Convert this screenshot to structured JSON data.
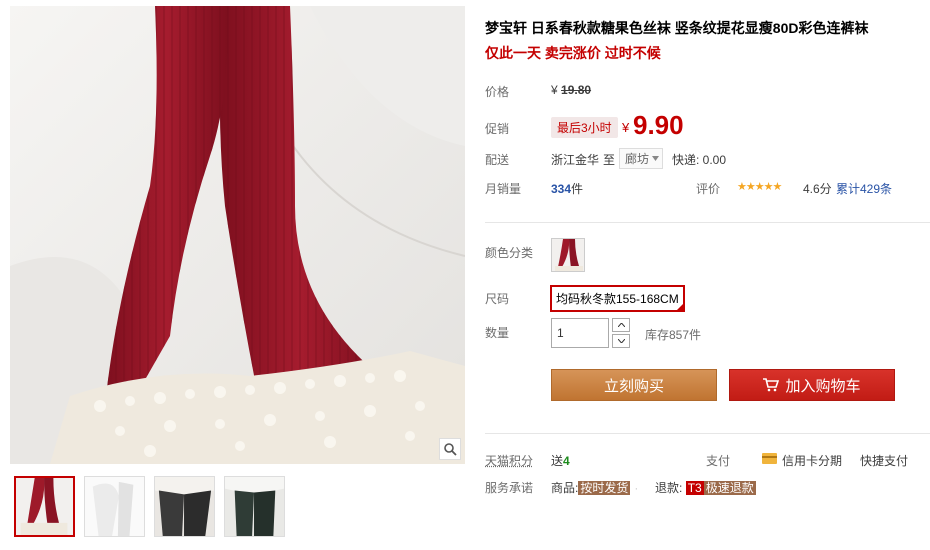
{
  "product": {
    "title": "梦宝轩 日系春秋款糖果色丝袜 竖条纹提花显瘦80D彩色连裤袜",
    "subtitle": "仅此一天 卖完涨价 过时不候"
  },
  "price": {
    "label": "价格",
    "currency": "¥",
    "original": "19.80"
  },
  "promo": {
    "label": "促销",
    "badge": "最后3小时",
    "currency": "¥",
    "price": "9.90"
  },
  "shipping": {
    "label": "配送",
    "from": "浙江金华",
    "to_word": "至",
    "destination": "廊坊",
    "fee": "快递: 0.00"
  },
  "sales": {
    "label": "月销量",
    "count": "334",
    "unit": "件",
    "rating_label": "评价",
    "stars": "★★★★★",
    "rating_value": 4.6,
    "score": "4.6分",
    "review_count": "累计429条"
  },
  "options": {
    "color_label": "颜色分类",
    "size_label": "尺码",
    "size_selected": "均码秋冬款155-168CM",
    "qty_label": "数量",
    "qty_value": "1",
    "stock": "库存857件"
  },
  "actions": {
    "buy_now": "立刻购买",
    "add_cart": "加入购物车"
  },
  "extra": {
    "points_label": "天猫积分",
    "points_give": "送",
    "points_value": "4",
    "pay_label": "支付",
    "credit": "信用卡分期",
    "fast_pay": "快捷支付",
    "service_label": "服务承诺",
    "goods_label": "商品:",
    "goods_badge": "按时发货",
    "refund_label": "退款:",
    "refund_code": "T3",
    "refund_badge": "极速退款"
  },
  "colors": {
    "accent": "#c40000",
    "buy_button": "#c8823c",
    "cart_button": "#c8231c",
    "link": "#2953a6",
    "stocking": "#9e1a2a"
  },
  "icons": {
    "zoom": "magnifier-icon",
    "cart": "cart-icon",
    "credit": "credit-card-icon",
    "dropdown": "chevron-down-icon"
  }
}
